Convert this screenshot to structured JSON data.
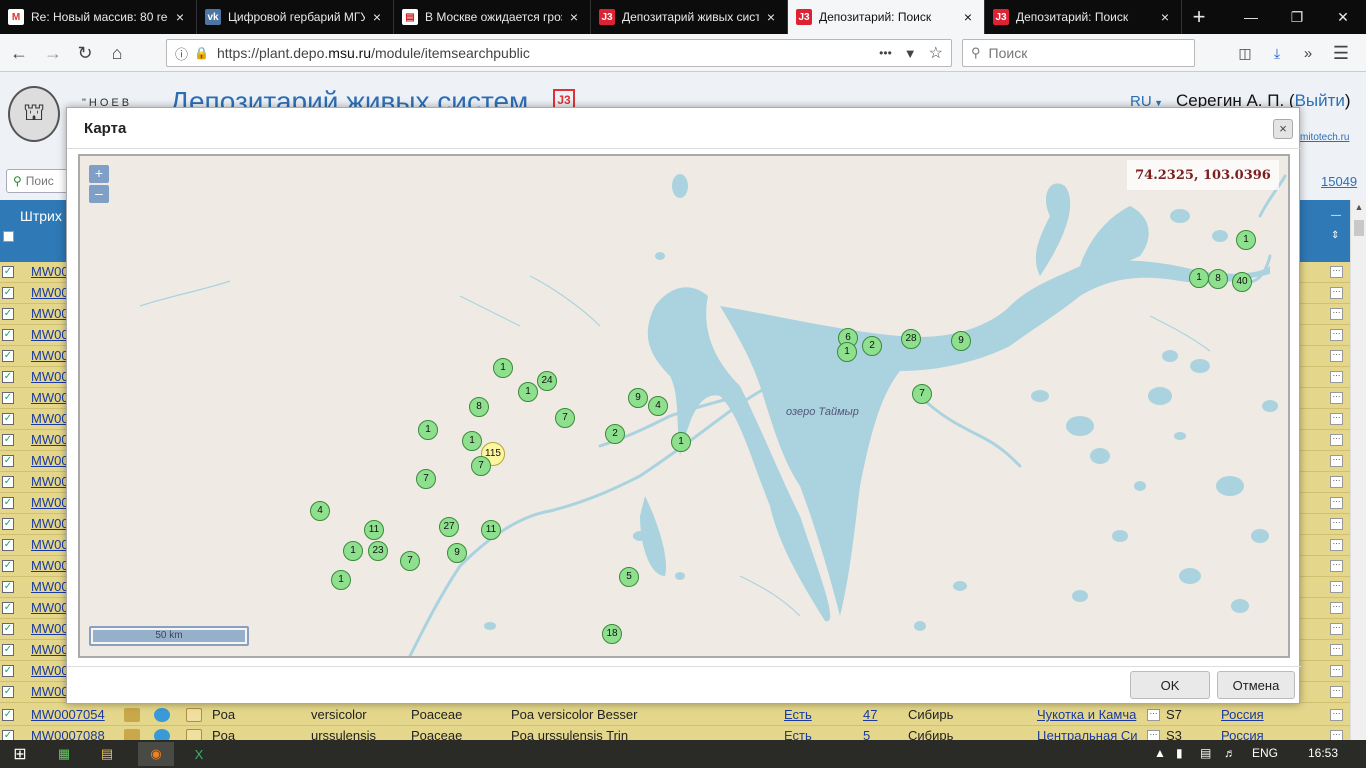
{
  "browser": {
    "tabs": [
      {
        "favicon": "gmail-icon",
        "favicon_text": "M",
        "title": "Re: Новый массив: 80 rec",
        "close": "×"
      },
      {
        "favicon": "vk-icon",
        "favicon_text": "vk",
        "title": "Цифровой гербарий МГУ",
        "close": "×"
      },
      {
        "favicon": "news-icon",
        "favicon_text": "▤",
        "title": "В Москве ожидается гроз",
        "close": "×"
      },
      {
        "favicon": "j3-icon",
        "favicon_text": "J3",
        "title": "Депозитарий живых сист",
        "close": "×"
      },
      {
        "favicon": "j3-icon",
        "favicon_text": "J3",
        "title": "Депозитарий: Поиск",
        "close": "×",
        "active": true
      },
      {
        "favicon": "j3-icon",
        "favicon_text": "J3",
        "title": "Депозитарий: Поиск",
        "close": "×"
      }
    ],
    "new_tab": "+",
    "window_controls": {
      "minimize": "—",
      "restore": "❐",
      "close": "✕"
    },
    "url_prefix": "https://plant.depo.",
    "url_domain": "msu.ru",
    "url_path": "/module/itemsearchpublic",
    "url_more": "•••",
    "search_placeholder": "Поиск"
  },
  "site": {
    "title": "Депозитарий живых систем",
    "logo_text": "J3",
    "subtitle_fragment": "\"НОЕВ",
    "lang": "RU",
    "user": "Серегин А. П.",
    "logout": "Выйти",
    "sponsor": "mitotech.ru",
    "filter_placeholder": "Поис",
    "total_count": "15049",
    "column_header": "Штрих"
  },
  "grid": {
    "row_id_fragment": "MW00",
    "visible_truncated_rows": 21,
    "rows": [
      {
        "id": "MW0007054",
        "genus": "Poa",
        "species": "versicolor",
        "family": "Poaceae",
        "name": "Poa versicolor Besser",
        "image": "Есть",
        "count": "47",
        "region": "Сибирь",
        "subregion": "Чукотка и Камча",
        "code": "S7",
        "country": "Россия"
      },
      {
        "id": "MW0007088",
        "genus": "Poa",
        "species": "urssulensis",
        "family": "Poaceae",
        "name": "Poa urssulensis Trin",
        "image": "Есть",
        "count": "5",
        "region": "Сибирь",
        "subregion": "Центральная Си",
        "code": "S3",
        "country": "Россия"
      }
    ]
  },
  "modal": {
    "title": "Карта",
    "close": "×",
    "ok": "OK",
    "cancel": "Отмена",
    "map": {
      "zoom_in": "+",
      "zoom_out": "–",
      "coordinates": "74.2325, 103.0396",
      "scale": "50 km",
      "lake_label": "озеро Таймыр",
      "colors": {
        "water": "#aad3df",
        "land": "#efebe4",
        "cluster": "#8ee08e",
        "cluster_large": "#fdf6a0"
      },
      "clusters": [
        {
          "count": "1"
        },
        {
          "count": "1"
        },
        {
          "count": "8"
        },
        {
          "count": "40"
        },
        {
          "count": "6"
        },
        {
          "count": "1"
        },
        {
          "count": "2"
        },
        {
          "count": "28"
        },
        {
          "count": "9"
        },
        {
          "count": "7"
        },
        {
          "count": "1"
        },
        {
          "count": "24"
        },
        {
          "count": "1"
        },
        {
          "count": "8"
        },
        {
          "count": "7"
        },
        {
          "count": "9"
        },
        {
          "count": "4"
        },
        {
          "count": "2"
        },
        {
          "count": "1"
        },
        {
          "count": "1"
        },
        {
          "count": "1"
        },
        {
          "count": "115"
        },
        {
          "count": "7"
        },
        {
          "count": "7"
        },
        {
          "count": "4"
        },
        {
          "count": "11"
        },
        {
          "count": "27"
        },
        {
          "count": "11"
        },
        {
          "count": "1"
        },
        {
          "count": "23"
        },
        {
          "count": "7"
        },
        {
          "count": "9"
        },
        {
          "count": "1"
        },
        {
          "count": "5"
        },
        {
          "count": "18"
        }
      ]
    }
  },
  "taskbar": {
    "lang": "ENG",
    "time": "16:53"
  }
}
